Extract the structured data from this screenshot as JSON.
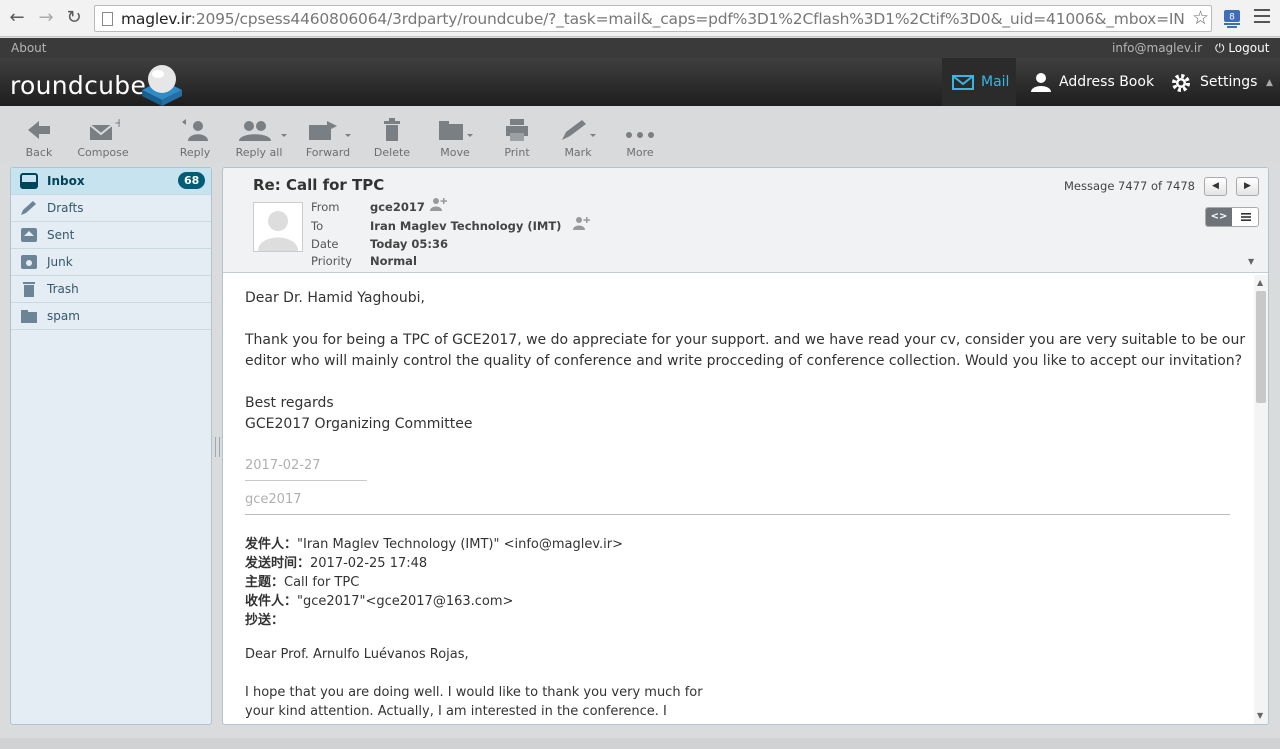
{
  "browser": {
    "url_host": "maglev.ir",
    "url_rest": ":2095/cpsess4460806064/3rdparty/roundcube/?_task=mail&_caps=pdf%3D1%2Cflash%3D1%2Ctif%3D0&_uid=41006&_mbox=INBOX&_actio",
    "extension_badge": "8"
  },
  "topline": {
    "about": "About",
    "user_email": "info@maglev.ir",
    "logout": "Logout"
  },
  "header": {
    "logo": "roundcube",
    "tasks": {
      "mail": "Mail",
      "address_book": "Address Book",
      "settings": "Settings"
    }
  },
  "toolbar": {
    "back": "Back",
    "compose": "Compose",
    "reply": "Reply",
    "reply_all": "Reply all",
    "forward": "Forward",
    "delete": "Delete",
    "move": "Move",
    "print": "Print",
    "mark": "Mark",
    "more": "More"
  },
  "folders": [
    {
      "name": "Inbox",
      "count": "68",
      "icon": "inbox-icon"
    },
    {
      "name": "Drafts",
      "icon": "pencil-icon"
    },
    {
      "name": "Sent",
      "icon": "sent-icon"
    },
    {
      "name": "Junk",
      "icon": "junk-icon"
    },
    {
      "name": "Trash",
      "icon": "trash-icon"
    },
    {
      "name": "spam",
      "icon": "folder-icon"
    }
  ],
  "message": {
    "subject": "Re: Call for TPC",
    "counter": "Message 7477 of 7478",
    "headers": {
      "from_label": "From",
      "from": "gce2017",
      "to_label": "To",
      "to": "Iran Maglev Technology (IMT)",
      "date_label": "Date",
      "date": "Today 05:36",
      "priority_label": "Priority",
      "priority": "Normal"
    },
    "body": {
      "greeting": "Dear Dr. Hamid Yaghoubi,",
      "para1_line1": "Thank you for being a TPC of GCE2017, we do appreciate for your support. and we have read your cv, consider you are very suitable to be our",
      "para1_line2": "editor who will  mainly control the quality of conference and write procceding of conference collection. Would you like to accept our invitation?",
      "regards": "Best regards",
      "committee": "GCE2017 Organizing Committee",
      "sig_date": "2017-02-27",
      "sig_name": "gce2017",
      "quoted": {
        "from_label": "发件人：",
        "from": "\"Iran Maglev Technology (IMT)\" <info@maglev.ir>",
        "sent_label": "发送时间：",
        "sent": "2017-02-25 17:48",
        "subject_label": "主题：",
        "subject": "Call for TPC",
        "to_label": "收件人：",
        "to": "\"gce2017\"<gce2017@163.com>",
        "cc_label": "抄送："
      },
      "quoted_greeting": "Dear Prof. Arnulfo Luévanos Rojas,",
      "quoted_line1": "I hope that you are doing well. I would like to thank you very much for",
      "quoted_line2": "your kind attention. Actually, I am interested in the conference. I"
    }
  },
  "colors": {
    "accent": "#3cb4e6",
    "badge": "#005d76",
    "selected_folder": "#c7e3ef"
  }
}
